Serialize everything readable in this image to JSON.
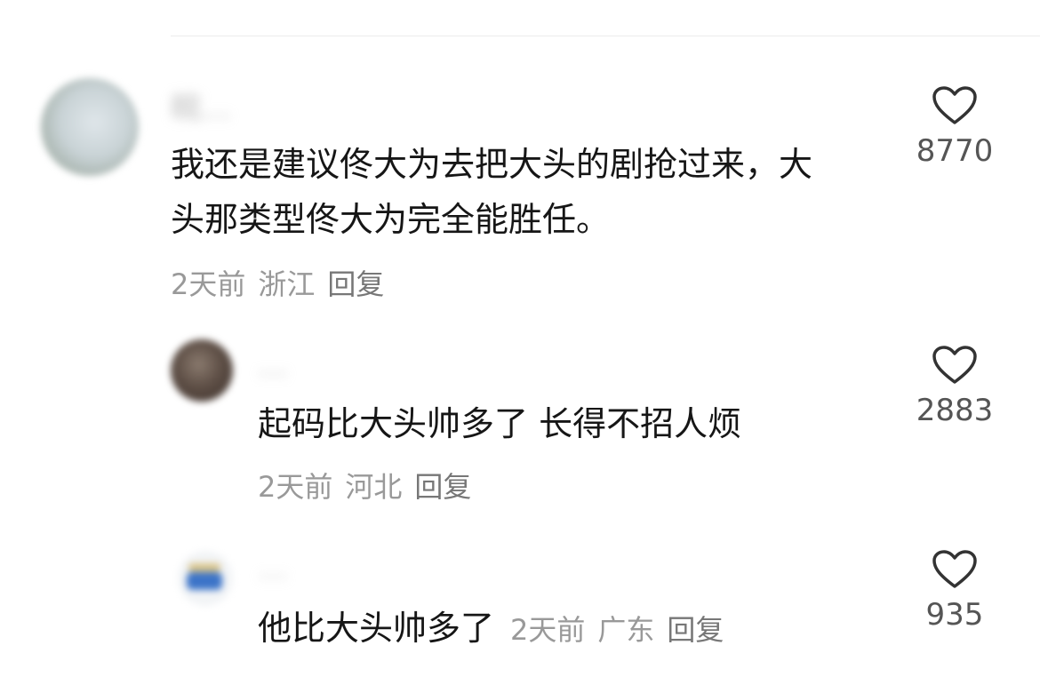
{
  "comments": [
    {
      "username": "皖…",
      "text_lines": [
        "我还是建议佟大为去把大头的剧抢过来，大",
        "头那类型佟大为完全能胜任。"
      ],
      "time": "2天前",
      "location": "浙江",
      "reply_label": "回复",
      "likes": "8770"
    },
    {
      "username": "…",
      "text_lines": [
        "起码比大头帅多了 长得不招人烦"
      ],
      "time": "2天前",
      "location": "河北",
      "reply_label": "回复",
      "likes": "2883"
    },
    {
      "username": "…",
      "text_lines": [
        "他比大头帅多了"
      ],
      "time": "2天前",
      "location": "广东",
      "reply_label": "回复",
      "likes": "935"
    }
  ],
  "icons": {
    "like": "heart-outline-icon"
  }
}
